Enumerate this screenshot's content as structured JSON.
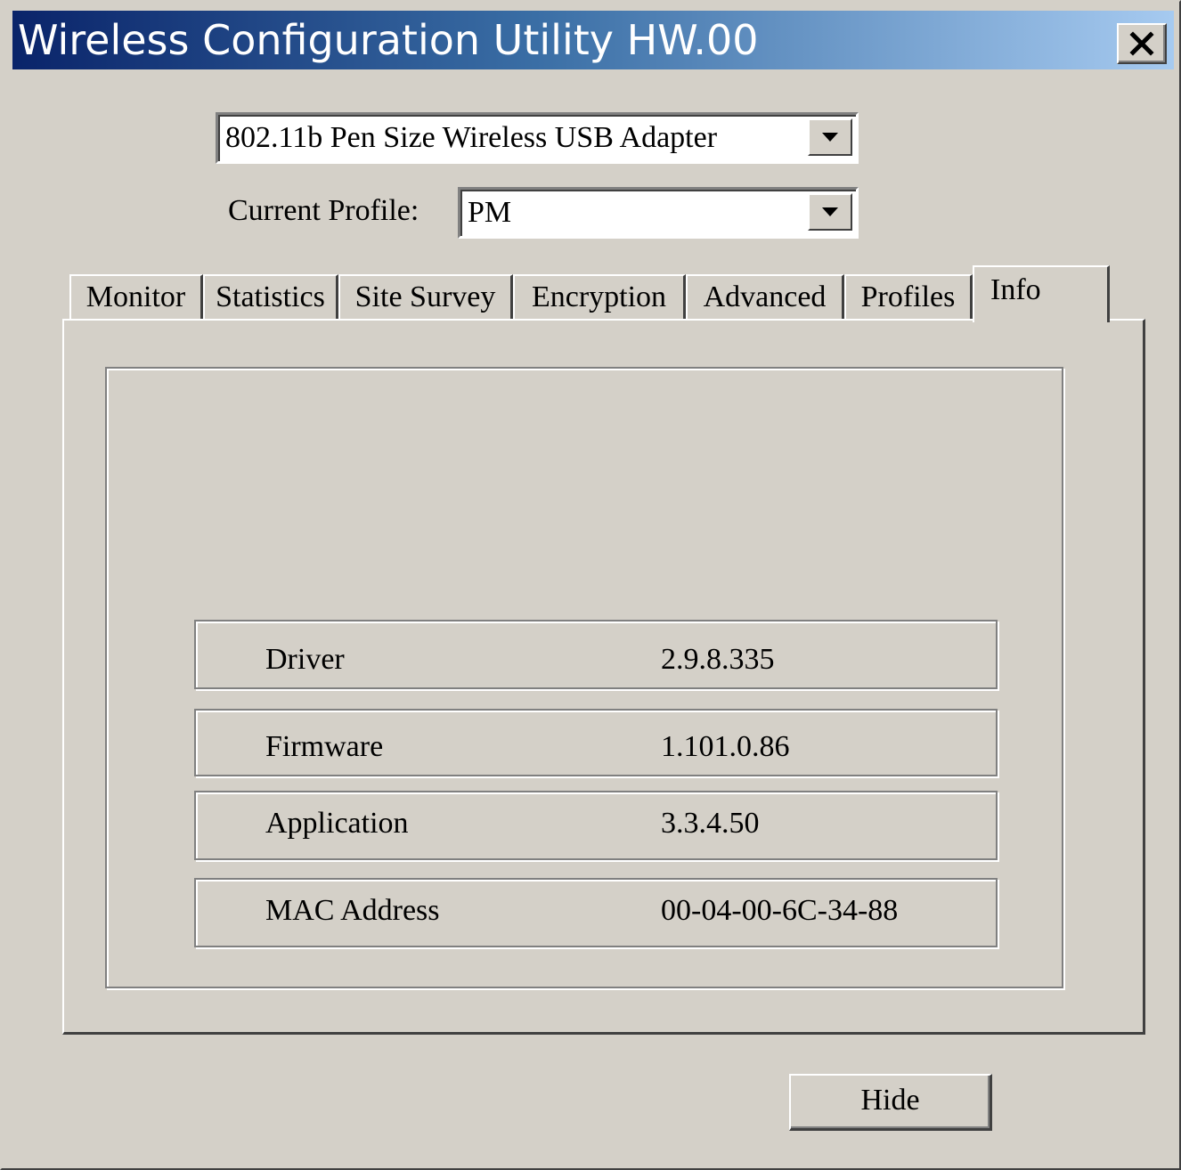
{
  "window": {
    "title": "Wireless Configuration Utility HW.00",
    "close_glyph": "✕"
  },
  "adapter": {
    "selected": "802.11b Pen Size Wireless USB Adapter"
  },
  "profile": {
    "label": "Current Profile:",
    "selected": "PM"
  },
  "tabs": [
    {
      "label": "Monitor"
    },
    {
      "label": "Statistics"
    },
    {
      "label": "Site Survey"
    },
    {
      "label": "Encryption"
    },
    {
      "label": "Advanced"
    },
    {
      "label": "Profiles"
    },
    {
      "label": "Info",
      "active": true
    }
  ],
  "info": {
    "rows": [
      {
        "key": "Driver",
        "value": "2.9.8.335"
      },
      {
        "key": "Firmware",
        "value": "1.101.0.86"
      },
      {
        "key": "Application",
        "value": "3.3.4.50"
      },
      {
        "key": "MAC Address",
        "value": "00-04-00-6C-34-88"
      }
    ]
  },
  "footer": {
    "hide_label": "Hide"
  },
  "colors": {
    "face": "#d4d0c8",
    "title_start": "#0a246a",
    "title_end": "#a6caf0"
  },
  "icons": {
    "close": "close-icon",
    "dropdown": "chevron-down-icon"
  }
}
